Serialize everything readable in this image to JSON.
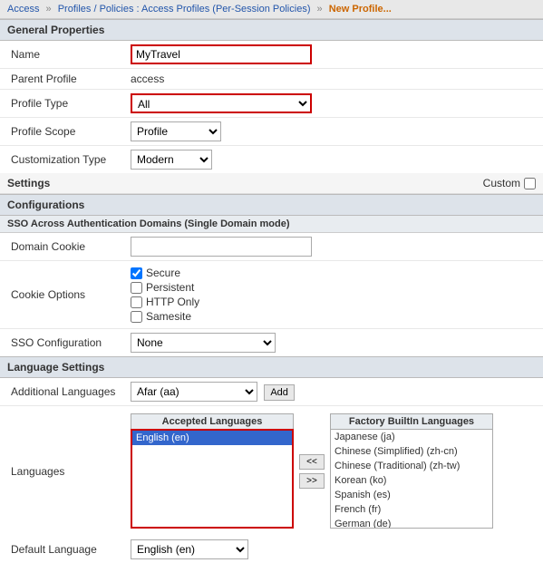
{
  "breadcrumb": {
    "items": [
      "Access",
      "Profiles / Policies : Access Profiles (Per-Session Policies)",
      "New Profile..."
    ],
    "separators": [
      "»",
      "»"
    ]
  },
  "sections": {
    "general_properties": {
      "label": "General Properties",
      "fields": {
        "name": {
          "label": "Name",
          "value": "MyTravel",
          "highlighted": true
        },
        "parent_profile": {
          "label": "Parent Profile",
          "value": "access"
        },
        "profile_type": {
          "label": "Profile Type",
          "value": "All",
          "highlighted": true
        },
        "profile_scope": {
          "label": "Profile Scope",
          "value": "Profile"
        },
        "customization_type": {
          "label": "Customization Type",
          "value": "Modern"
        }
      }
    },
    "settings": {
      "label": "Settings",
      "custom_label": "Custom"
    },
    "configurations": {
      "label": "Configurations",
      "sso_section": {
        "label": "SSO Across Authentication Domains (Single Domain mode)",
        "fields": {
          "domain_cookie": {
            "label": "Domain Cookie",
            "value": ""
          },
          "cookie_options": {
            "label": "Cookie Options",
            "options": [
              {
                "label": "Secure",
                "checked": true
              },
              {
                "label": "Persistent",
                "checked": false
              },
              {
                "label": "HTTP Only",
                "checked": false
              },
              {
                "label": "Samesite",
                "checked": false
              }
            ]
          },
          "sso_configuration": {
            "label": "SSO Configuration",
            "value": "None"
          }
        }
      }
    },
    "language_settings": {
      "label": "Language Settings",
      "additional_languages": {
        "label": "Additional Languages",
        "value": "Afar (aa)",
        "add_button": "Add"
      },
      "languages": {
        "label": "Languages",
        "accepted_header": "Accepted Languages",
        "factory_header": "Factory BuiltIn Languages",
        "accepted": [
          "English (en)"
        ],
        "factory": [
          "Japanese (ja)",
          "Chinese (Simplified) (zh-cn)",
          "Chinese (Traditional) (zh-tw)",
          "Korean (ko)",
          "Spanish (es)",
          "French (fr)",
          "German (de)"
        ],
        "btn_left": "<<",
        "btn_right": ">>"
      },
      "default_language": {
        "label": "Default Language",
        "value": "English (en)"
      }
    }
  }
}
